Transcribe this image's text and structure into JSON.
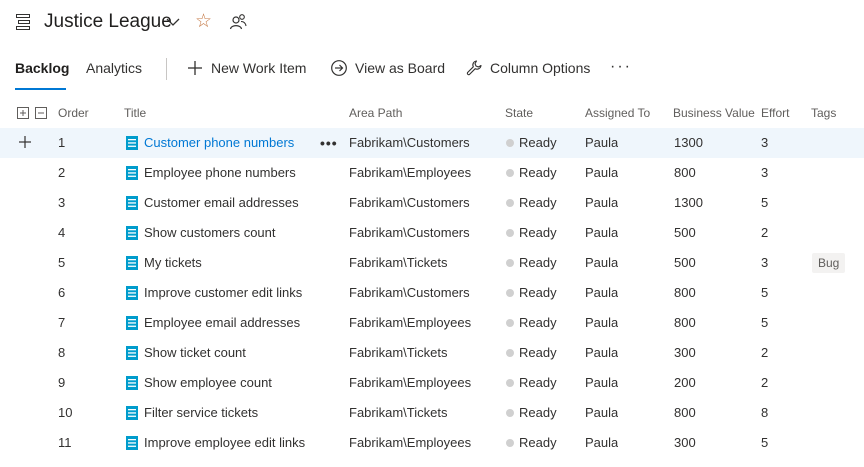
{
  "header": {
    "team_name": "Justice League",
    "favorite_icon": "star-icon",
    "team_members_icon": "people-icon"
  },
  "toolbar": {
    "tabs": [
      {
        "label": "Backlog",
        "active": true
      },
      {
        "label": "Analytics",
        "active": false
      }
    ],
    "new_work_item": "New Work Item",
    "view_as_board": "View as Board",
    "column_options": "Column Options",
    "more": "···"
  },
  "grid": {
    "columns": [
      "Order",
      "Title",
      "Area Path",
      "State",
      "Assigned To",
      "Business Value",
      "Effort",
      "Tags"
    ],
    "rows": [
      {
        "order": "1",
        "title": "Customer phone numbers",
        "area": "Fabrikam\\Customers",
        "state": "Ready",
        "assigned": "Paula",
        "bv": "1300",
        "effort": "3",
        "tag": "",
        "selected": true
      },
      {
        "order": "2",
        "title": "Employee phone numbers",
        "area": "Fabrikam\\Employees",
        "state": "Ready",
        "assigned": "Paula",
        "bv": "800",
        "effort": "3",
        "tag": ""
      },
      {
        "order": "3",
        "title": "Customer email addresses",
        "area": "Fabrikam\\Customers",
        "state": "Ready",
        "assigned": "Paula",
        "bv": "1300",
        "effort": "5",
        "tag": ""
      },
      {
        "order": "4",
        "title": "Show customers count",
        "area": "Fabrikam\\Customers",
        "state": "Ready",
        "assigned": "Paula",
        "bv": "500",
        "effort": "2",
        "tag": ""
      },
      {
        "order": "5",
        "title": "My tickets",
        "area": "Fabrikam\\Tickets",
        "state": "Ready",
        "assigned": "Paula",
        "bv": "500",
        "effort": "3",
        "tag": "Bug"
      },
      {
        "order": "6",
        "title": "Improve customer edit links",
        "area": "Fabrikam\\Customers",
        "state": "Ready",
        "assigned": "Paula",
        "bv": "800",
        "effort": "5",
        "tag": ""
      },
      {
        "order": "7",
        "title": "Employee email addresses",
        "area": "Fabrikam\\Employees",
        "state": "Ready",
        "assigned": "Paula",
        "bv": "800",
        "effort": "5",
        "tag": ""
      },
      {
        "order": "8",
        "title": "Show ticket count",
        "area": "Fabrikam\\Tickets",
        "state": "Ready",
        "assigned": "Paula",
        "bv": "300",
        "effort": "2",
        "tag": ""
      },
      {
        "order": "9",
        "title": "Show employee count",
        "area": "Fabrikam\\Employees",
        "state": "Ready",
        "assigned": "Paula",
        "bv": "200",
        "effort": "2",
        "tag": ""
      },
      {
        "order": "10",
        "title": "Filter service tickets",
        "area": "Fabrikam\\Tickets",
        "state": "Ready",
        "assigned": "Paula",
        "bv": "800",
        "effort": "8",
        "tag": ""
      },
      {
        "order": "11",
        "title": "Improve employee edit links",
        "area": "Fabrikam\\Employees",
        "state": "Ready",
        "assigned": "Paula",
        "bv": "300",
        "effort": "5",
        "tag": ""
      }
    ]
  },
  "colors": {
    "accent": "#0078d4",
    "selected_row": "#eff6fc",
    "state_ready_dot": "#d0d0d0",
    "work_item_icon": "#009ccc"
  }
}
